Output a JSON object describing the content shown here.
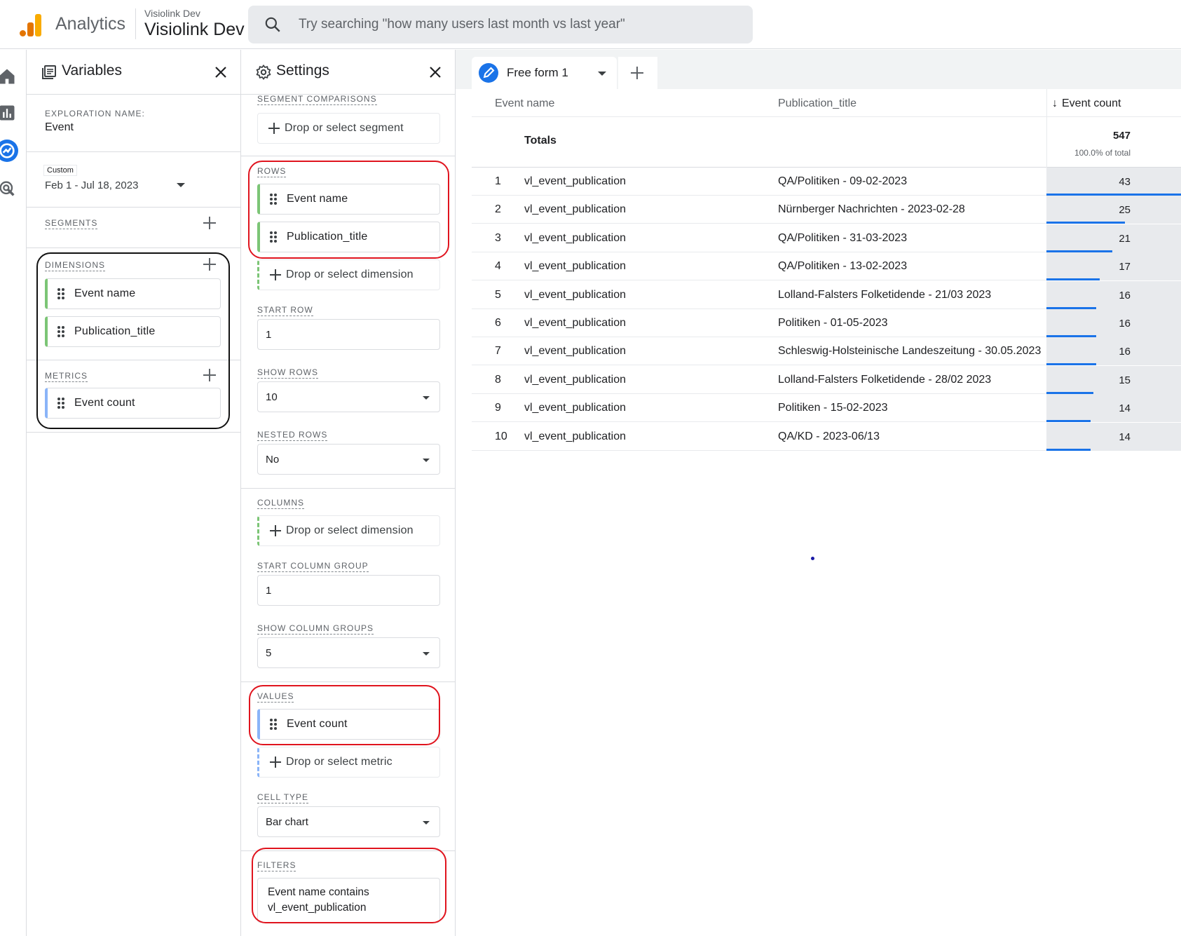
{
  "header": {
    "app_name": "Analytics",
    "account_small": "Visiolink Dev",
    "account_big": "Visiolink Dev",
    "search_placeholder": "Try searching \"how many users last month vs last year\""
  },
  "rail": [
    "home-icon",
    "reports-icon",
    "explore-icon",
    "advertising-icon"
  ],
  "variables": {
    "title": "Variables",
    "exploration_label": "EXPLORATION NAME:",
    "exploration_name": "Event",
    "date_tag": "Custom",
    "date_range": "Feb 1 - Jul 18, 2023",
    "segments_label": "SEGMENTS",
    "dimensions_label": "DIMENSIONS",
    "dimensions": [
      "Event name",
      "Publication_title"
    ],
    "metrics_label": "METRICS",
    "metrics": [
      "Event count"
    ]
  },
  "settings": {
    "title": "Settings",
    "segment_comparisons_label": "SEGMENT COMPARISONS",
    "segment_drop": "Drop or select segment",
    "rows_label": "ROWS",
    "rows": [
      "Event name",
      "Publication_title"
    ],
    "dimension_drop": "Drop or select dimension",
    "start_row_label": "START ROW",
    "start_row": "1",
    "show_rows_label": "SHOW ROWS",
    "show_rows": "10",
    "nested_rows_label": "NESTED ROWS",
    "nested_rows": "No",
    "columns_label": "COLUMNS",
    "column_drop": "Drop or select dimension",
    "start_column_group_label": "START COLUMN GROUP",
    "start_column_group": "1",
    "show_column_groups_label": "SHOW COLUMN GROUPS",
    "show_column_groups": "5",
    "values_label": "VALUES",
    "values": [
      "Event count"
    ],
    "metric_drop": "Drop or select metric",
    "cell_type_label": "CELL TYPE",
    "cell_type": "Bar chart",
    "filters_label": "FILTERS",
    "filter_line1": "Event name contains",
    "filter_line2": "vl_event_publication"
  },
  "tab": {
    "label": "Free form 1"
  },
  "table": {
    "headers": [
      "Event name",
      "Publication_title",
      "Event count"
    ],
    "totals_label": "Totals",
    "total_value": "547",
    "total_pct": "100.0% of total",
    "rows": [
      {
        "i": "1",
        "event": "vl_event_publication",
        "title": "QA/Politiken - 09-02-2023",
        "count": "43",
        "n": 43
      },
      {
        "i": "2",
        "event": "vl_event_publication",
        "title": "Nürnberger Nachrichten - 2023-02-28",
        "count": "25",
        "n": 25
      },
      {
        "i": "3",
        "event": "vl_event_publication",
        "title": "QA/Politiken - 31-03-2023",
        "count": "21",
        "n": 21
      },
      {
        "i": "4",
        "event": "vl_event_publication",
        "title": "QA/Politiken - 13-02-2023",
        "count": "17",
        "n": 17
      },
      {
        "i": "5",
        "event": "vl_event_publication",
        "title": "Lolland-Falsters Folketidende - 21/03 2023",
        "count": "16",
        "n": 16
      },
      {
        "i": "6",
        "event": "vl_event_publication",
        "title": "Politiken - 01-05-2023",
        "count": "16",
        "n": 16
      },
      {
        "i": "7",
        "event": "vl_event_publication",
        "title": "Schleswig-Holsteinische Landeszeitung - 30.05.2023",
        "count": "16",
        "n": 16
      },
      {
        "i": "8",
        "event": "vl_event_publication",
        "title": "Lolland-Falsters Folketidende - 28/02 2023",
        "count": "15",
        "n": 15
      },
      {
        "i": "9",
        "event": "vl_event_publication",
        "title": "Politiken - 15-02-2023",
        "count": "14",
        "n": 14
      },
      {
        "i": "10",
        "event": "vl_event_publication",
        "title": "QA/KD - 2023-06/13",
        "count": "14",
        "n": 14
      }
    ]
  },
  "colors": {
    "accent": "#1a73e8",
    "dimension": "#7cc576",
    "metric": "#8ab4f8",
    "annotation_red": "#e0141e"
  }
}
